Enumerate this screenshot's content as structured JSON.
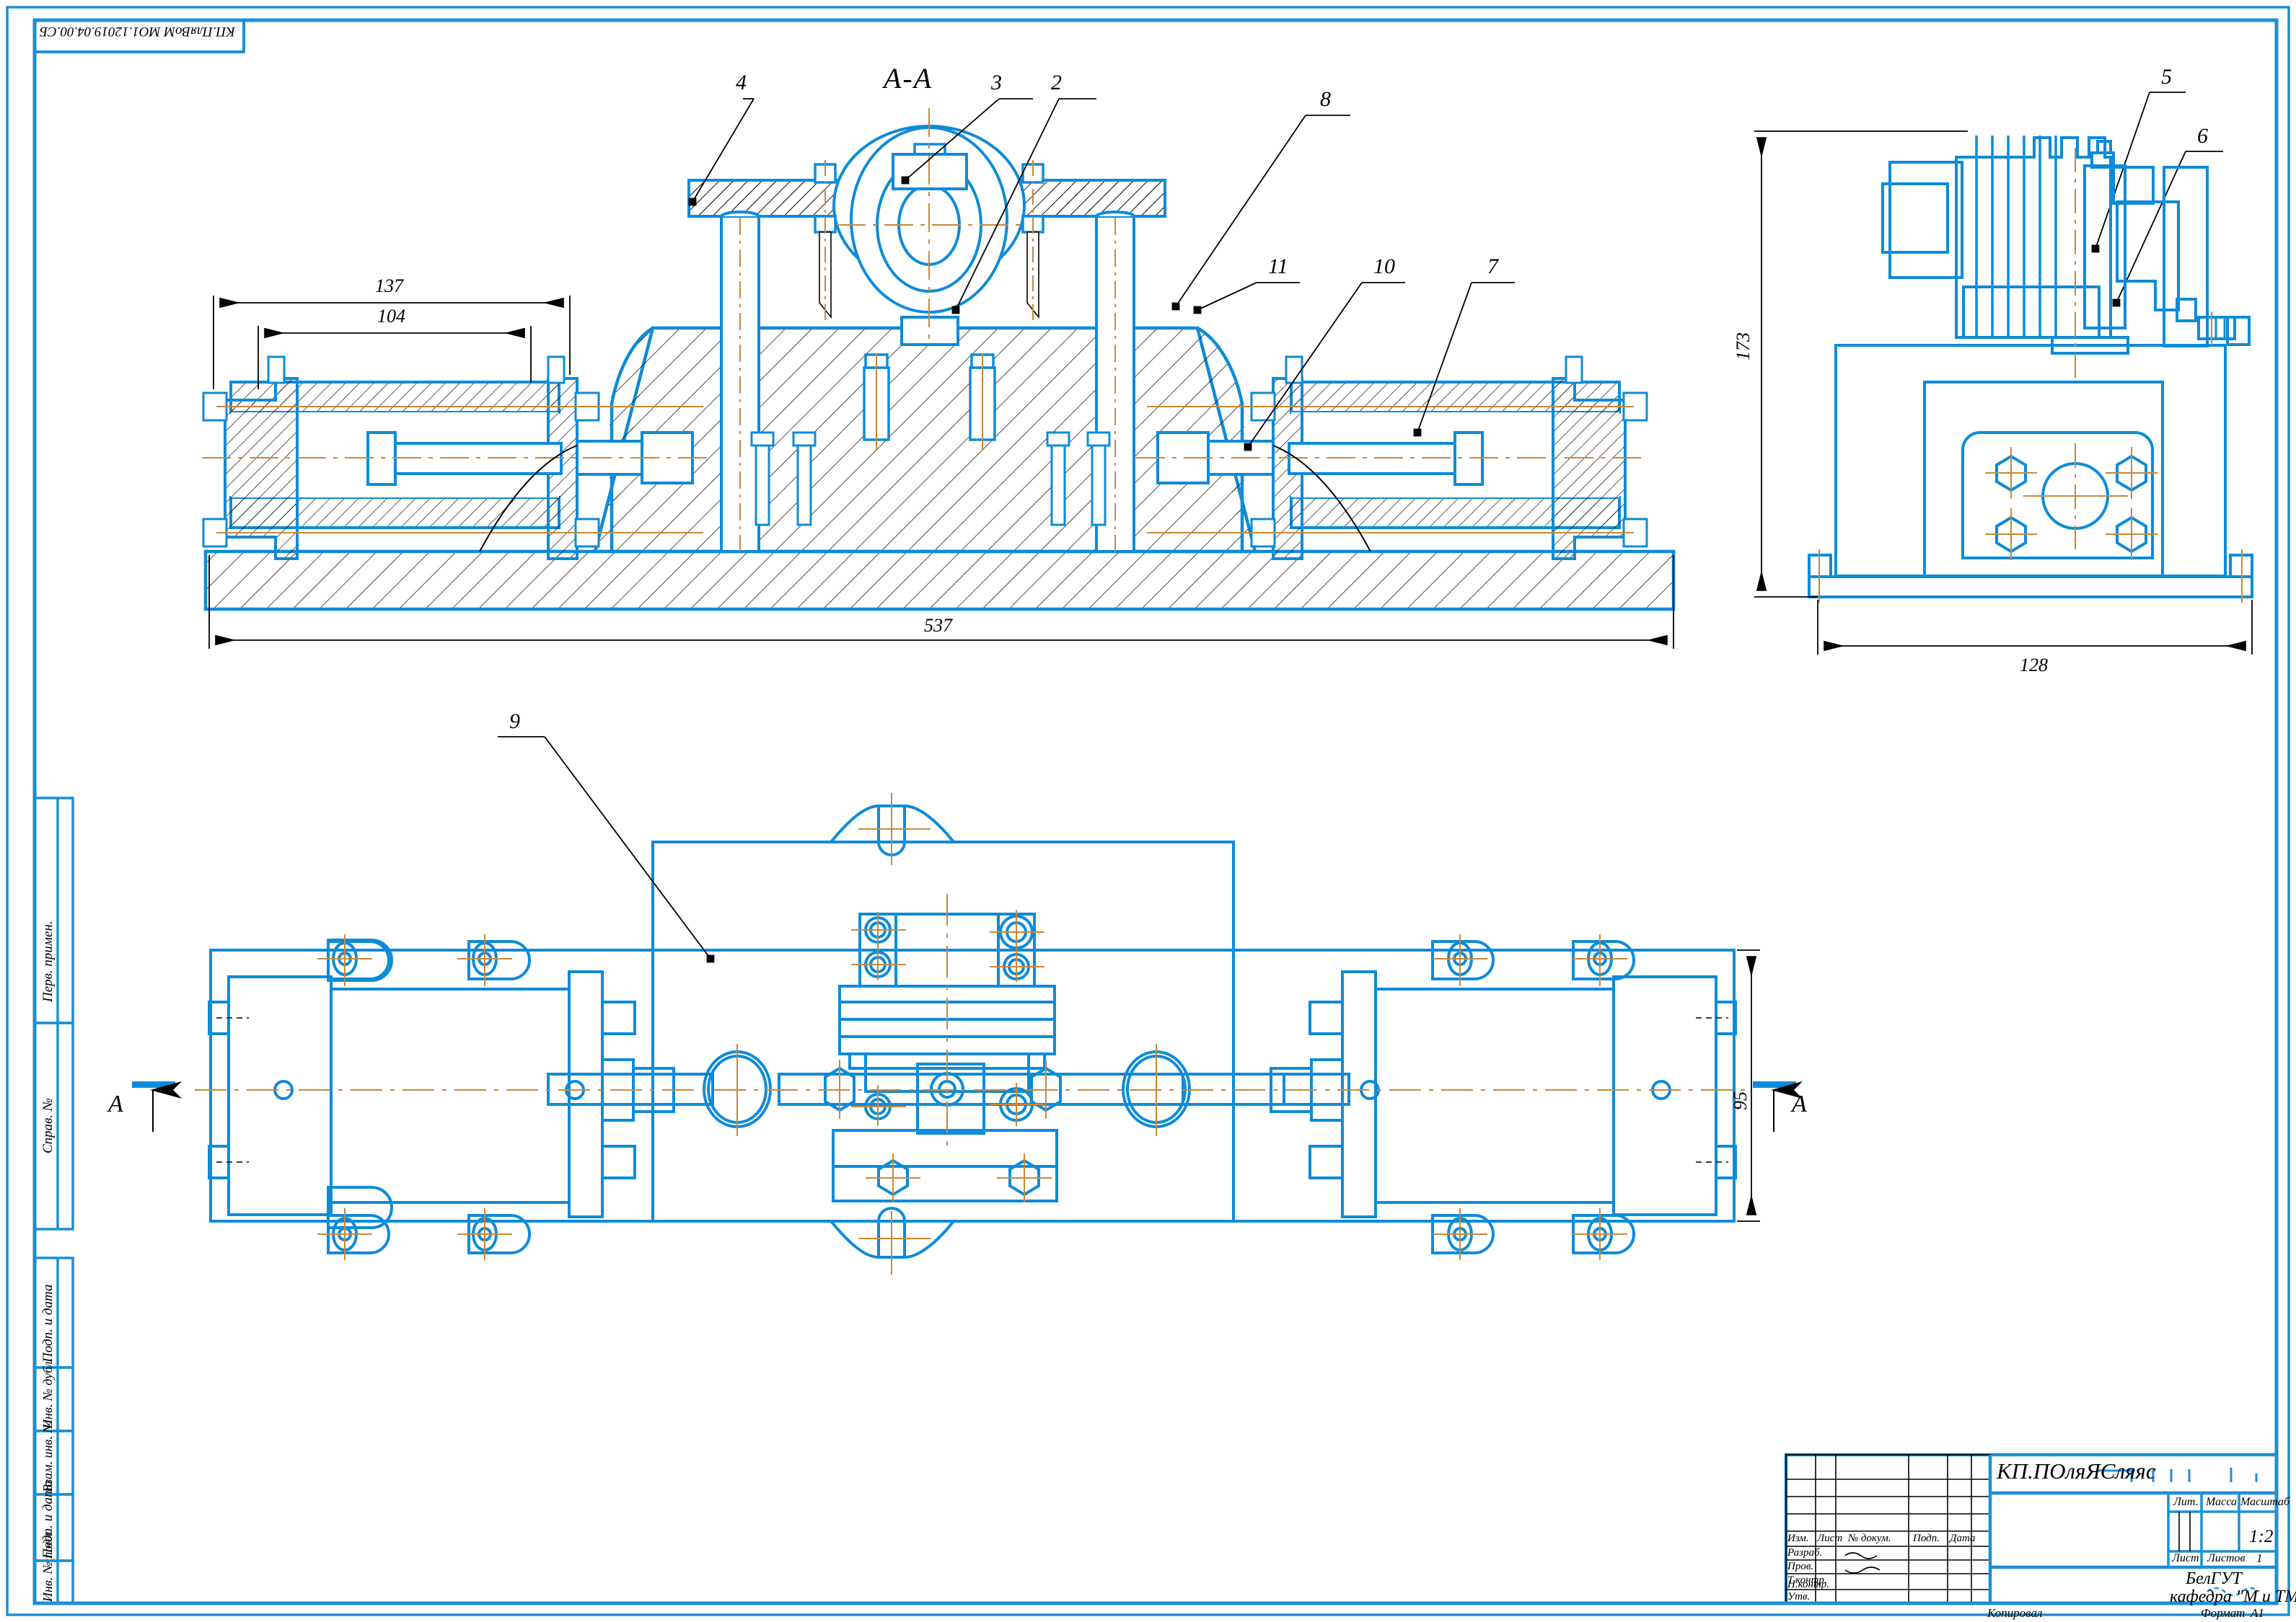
{
  "document": {
    "format_label": "Формат",
    "format_value": "A1",
    "copied_label": "Копировал",
    "stamp_top_left": "КП.ПляВоМ МО1.12019.04.00.СБ"
  },
  "views": {
    "section_title": "A-A",
    "section_mark_left": "A",
    "section_mark_right": "A"
  },
  "dimensions": {
    "front_outer": "537",
    "front_inner_1": "137",
    "front_inner_2": "104",
    "side_height": "173",
    "side_width": "128",
    "plan_width": "95"
  },
  "balloons": [
    {
      "id": "b2",
      "label": "2"
    },
    {
      "id": "b3",
      "label": "3"
    },
    {
      "id": "b4",
      "label": "4"
    },
    {
      "id": "b5",
      "label": "5"
    },
    {
      "id": "b6",
      "label": "6"
    },
    {
      "id": "b7",
      "label": "7"
    },
    {
      "id": "b8",
      "label": "8"
    },
    {
      "id": "b9",
      "label": "9"
    },
    {
      "id": "b10",
      "label": "10"
    },
    {
      "id": "b11",
      "label": "11"
    }
  ],
  "margin_labels": {
    "perv_primen": "Перв. примен.",
    "sprav_no": "Справ. №",
    "podp_data_1": "Подп. и дата",
    "inv_dubl": "Инв. № дубл.",
    "vzam_inv": "Взам. инв. №",
    "podp_data_2": "Подп. и дата",
    "inv_podl": "Инв. № подл."
  },
  "title_block": {
    "drawing_number": "КП.ПОляЯСляяс",
    "rev_headers": [
      "Изм.",
      "Лист",
      "№ докум.",
      "Подп.",
      "Дата"
    ],
    "roles": [
      "Разраб.",
      "Пров.",
      "Т.контр.",
      "",
      "Н.контр.",
      "Утв."
    ],
    "lit_label": "Лит.",
    "massa_label": "Масса",
    "masshtab_label": "Масштаб",
    "masshtab_value": "1:2",
    "list_label": "Лист",
    "listov_label": "Листов",
    "listov_value": "1",
    "org_line_1": "БелГУТ",
    "org_line_2": "кафедра \"М и ТМ\""
  },
  "colors": {
    "cad_blue": "#0d8bd9",
    "cad_black": "#000000",
    "center_orange": "#c8883c",
    "frame_blue": "#1b8fd6"
  }
}
